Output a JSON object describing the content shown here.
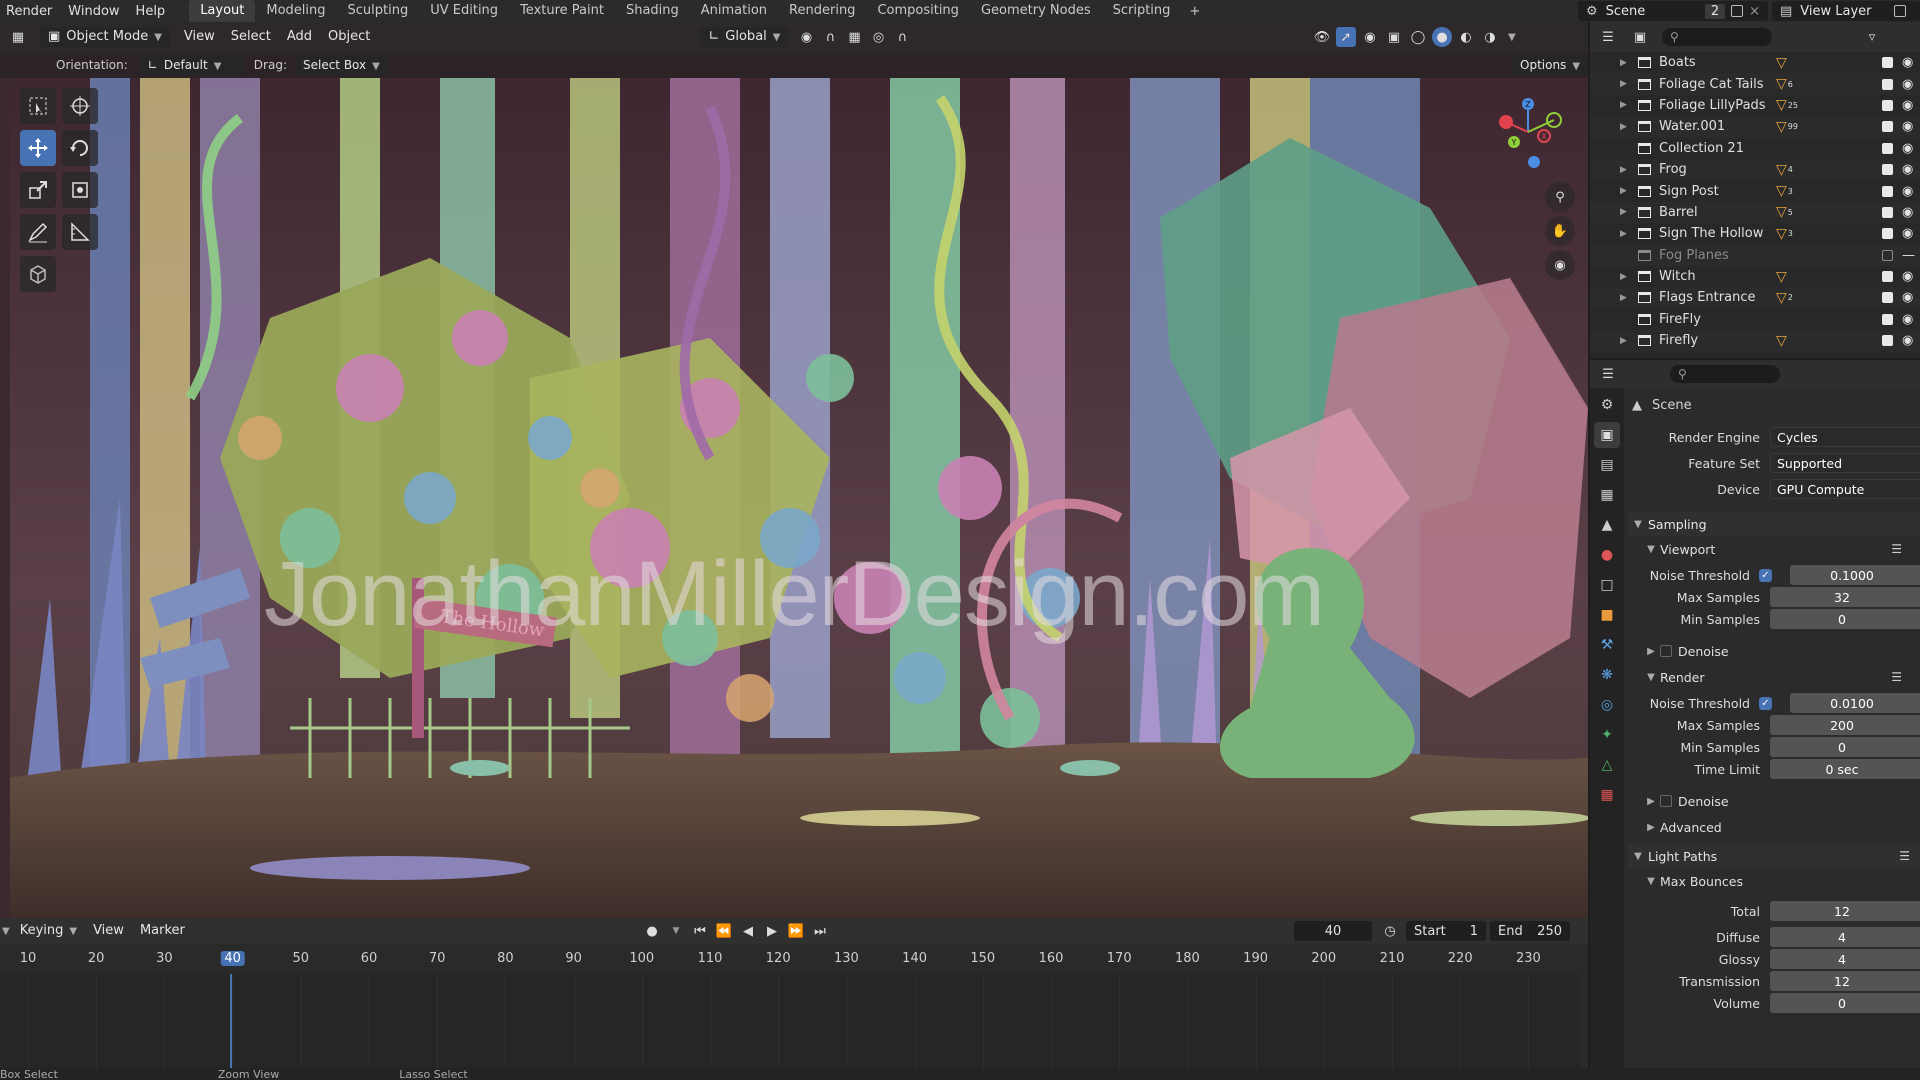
{
  "topbar": {
    "menus": [
      "Render",
      "Window",
      "Help"
    ],
    "workspaces": [
      "Layout",
      "Modeling",
      "Sculpting",
      "UV Editing",
      "Texture Paint",
      "Shading",
      "Animation",
      "Rendering",
      "Compositing",
      "Geometry Nodes",
      "Scripting"
    ],
    "active_workspace": "Layout",
    "add_workspace": "+",
    "scene_label": "Scene",
    "scene_number": "2",
    "view_layer_label": "View Layer"
  },
  "viewport": {
    "mode": "Object Mode",
    "menus": [
      "View",
      "Select",
      "Add",
      "Object"
    ],
    "transform_orientation": "Global",
    "orientation_label": "Orientation:",
    "orientation_value": "Default",
    "drag_label": "Drag:",
    "drag_value": "Select Box",
    "options_label": "Options",
    "watermark": "JonathanMillerDesign.com",
    "sign_text": "The Hollow",
    "gizmo_axes": {
      "x": "X",
      "y": "Y",
      "z": "Z"
    },
    "colors": {
      "x_axis": "#e0434e",
      "y_axis": "#8fcf3a",
      "z_axis": "#4a8ee6"
    }
  },
  "timeline": {
    "menus": [
      "Keying",
      "View",
      "Marker"
    ],
    "current_frame": "40",
    "start_label": "Start",
    "start_value": "1",
    "end_label": "End",
    "end_value": "250",
    "ruler": [
      "10",
      "20",
      "30",
      "40",
      "50",
      "60",
      "70",
      "80",
      "90",
      "100",
      "110",
      "120",
      "130",
      "140",
      "150",
      "160",
      "170",
      "180",
      "190",
      "200",
      "210",
      "220",
      "230"
    ]
  },
  "statusbar": {
    "items": [
      "Box Select",
      "Zoom View",
      "Lasso Select"
    ]
  },
  "outliner": {
    "rows": [
      {
        "name": "Boats",
        "badge": "",
        "dim": false,
        "expandable": true
      },
      {
        "name": "Foliage Cat Tails",
        "badge": "6",
        "dim": false,
        "expandable": true
      },
      {
        "name": "Foliage LillyPads",
        "badge": "25",
        "dim": false,
        "expandable": true
      },
      {
        "name": "Water.001",
        "badge": "99",
        "dim": false,
        "expandable": true
      },
      {
        "name": "Collection 21",
        "badge": "",
        "dim": false,
        "expandable": false
      },
      {
        "name": "Frog",
        "badge": "4",
        "dim": false,
        "expandable": true
      },
      {
        "name": "Sign Post",
        "badge": "3",
        "dim": false,
        "expandable": true
      },
      {
        "name": "Barrel",
        "badge": "5",
        "dim": false,
        "expandable": true
      },
      {
        "name": "Sign The Hollow",
        "badge": "3",
        "dim": false,
        "expandable": true
      },
      {
        "name": "Fog Planes",
        "badge": "",
        "dim": true,
        "expandable": false
      },
      {
        "name": "Witch",
        "badge": "",
        "dim": false,
        "expandable": true
      },
      {
        "name": "Flags Entrance",
        "badge": "2",
        "dim": false,
        "expandable": true
      },
      {
        "name": "FireFly",
        "badge": "",
        "dim": false,
        "expandable": false
      },
      {
        "name": "Firefly",
        "badge": "",
        "dim": false,
        "expandable": true
      }
    ]
  },
  "properties": {
    "context": "Scene",
    "render_engine_label": "Render Engine",
    "render_engine": "Cycles",
    "feature_set_label": "Feature Set",
    "feature_set": "Supported",
    "device_label": "Device",
    "device": "GPU Compute",
    "sampling": {
      "title": "Sampling",
      "viewport_title": "Viewport",
      "vp_noise_label": "Noise Threshold",
      "vp_noise": "0.1000",
      "vp_max_label": "Max Samples",
      "vp_max": "32",
      "vp_min_label": "Min Samples",
      "vp_min": "0",
      "denoise_label": "Denoise",
      "render_title": "Render",
      "r_noise_label": "Noise Threshold",
      "r_noise": "0.0100",
      "r_max_label": "Max Samples",
      "r_max": "200",
      "r_min_label": "Min Samples",
      "r_min": "0",
      "time_limit_label": "Time Limit",
      "time_limit": "0 sec",
      "denoise2_label": "Denoise",
      "advanced_label": "Advanced"
    },
    "light_paths": {
      "title": "Light Paths",
      "max_bounces_title": "Max Bounces",
      "total_label": "Total",
      "total": "12",
      "diffuse_label": "Diffuse",
      "diffuse": "4",
      "glossy_label": "Glossy",
      "glossy": "4",
      "transmission_label": "Transmission",
      "transmission": "12",
      "volume_label": "Volume",
      "volume": "0"
    }
  }
}
